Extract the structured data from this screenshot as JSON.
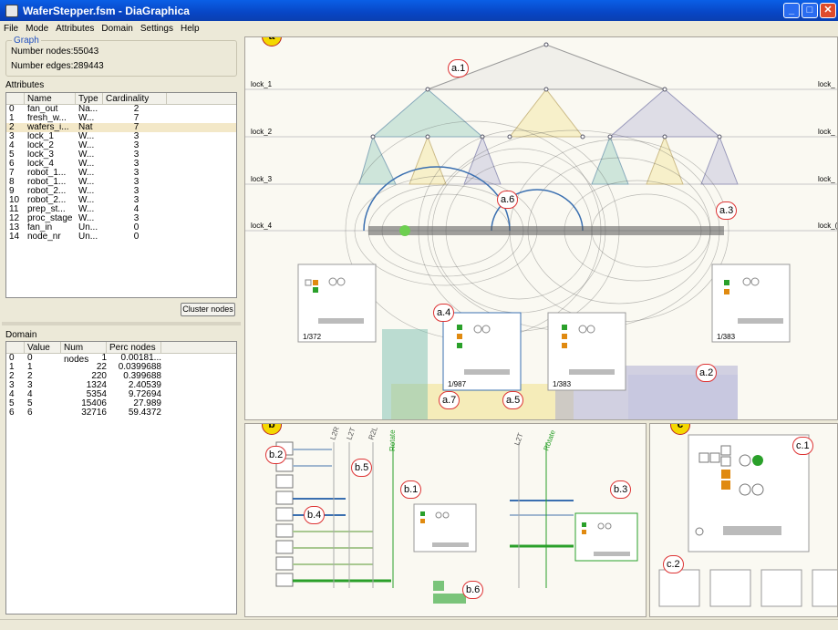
{
  "window": {
    "title": "WaferStepper.fsm - DiaGraphica"
  },
  "menu": [
    "File",
    "Mode",
    "Attributes",
    "Domain",
    "Settings",
    "Help"
  ],
  "graph": {
    "legend": "Graph",
    "nodes": "Number nodes:55043",
    "edges": "Number edges:289443"
  },
  "attributes": {
    "label": "Attributes",
    "columns": [
      "",
      "Name",
      "Type",
      "Cardinality"
    ],
    "rows": [
      [
        "0",
        "fan_out",
        "Na...",
        "2"
      ],
      [
        "1",
        "fresh_w...",
        "W...",
        "7"
      ],
      [
        "2",
        "wafers_i...",
        "Nat",
        "7"
      ],
      [
        "3",
        "lock_1",
        "W...",
        "3"
      ],
      [
        "4",
        "lock_2",
        "W...",
        "3"
      ],
      [
        "5",
        "lock_3",
        "W...",
        "3"
      ],
      [
        "6",
        "lock_4",
        "W...",
        "3"
      ],
      [
        "7",
        "robot_1...",
        "W...",
        "3"
      ],
      [
        "8",
        "robot_1...",
        "W...",
        "3"
      ],
      [
        "9",
        "robot_2...",
        "W...",
        "3"
      ],
      [
        "10",
        "robot_2...",
        "W...",
        "3"
      ],
      [
        "11",
        "prep_st...",
        "W...",
        "4"
      ],
      [
        "12",
        "proc_stage",
        "W...",
        "3"
      ],
      [
        "13",
        "fan_in",
        "Un...",
        "0"
      ],
      [
        "14",
        "node_nr",
        "Un...",
        "0"
      ]
    ],
    "selected_index": 2
  },
  "cluster_button": "Cluster nodes",
  "domain": {
    "label": "Domain",
    "columns": [
      "",
      "Value",
      "Num nodes",
      "Perc nodes"
    ],
    "rows": [
      [
        "0",
        "0",
        "1",
        "0.00181..."
      ],
      [
        "1",
        "1",
        "22",
        "0.0399688"
      ],
      [
        "2",
        "2",
        "220",
        "0.399688"
      ],
      [
        "3",
        "3",
        "1324",
        "2.40539"
      ],
      [
        "4",
        "4",
        "5354",
        "9.72694"
      ],
      [
        "5",
        "5",
        "15406",
        "27.989"
      ],
      [
        "6",
        "6",
        "32716",
        "59.4372"
      ]
    ]
  },
  "markers": {
    "a": "a",
    "b": "b",
    "c": "c"
  },
  "levels": [
    "lock_1",
    "lock_2",
    "lock_3",
    "lock_4"
  ],
  "levels_right": [
    "lock_",
    "lock_",
    "lock_",
    "lock_("
  ],
  "annotations": {
    "a1": "a.1",
    "a2": "a.2",
    "a3": "a.3",
    "a4": "a.4",
    "a5": "a.5",
    "a6": "a.6",
    "a7": "a.7",
    "b1": "b.1",
    "b2": "b.2",
    "b3": "b.3",
    "b4": "b.4",
    "b5": "b.5",
    "b6": "b.6",
    "c1": "c.1",
    "c2": "c.2"
  },
  "diagram_counters": [
    "1/372",
    "1/987",
    "1/383",
    "1/383"
  ],
  "arc_labels": {
    "l2r": "L2R",
    "l2t": "L2T",
    "r2l": "R2L",
    "rotate": "Rotate"
  },
  "colors": {
    "accent": "#f4d800",
    "teal": "#7cc0b0",
    "lilac": "#a8a8d0",
    "yellow": "#f0e080",
    "green": "#2aa02a",
    "blue": "#3a6fb0",
    "orange": "#e08a10"
  }
}
